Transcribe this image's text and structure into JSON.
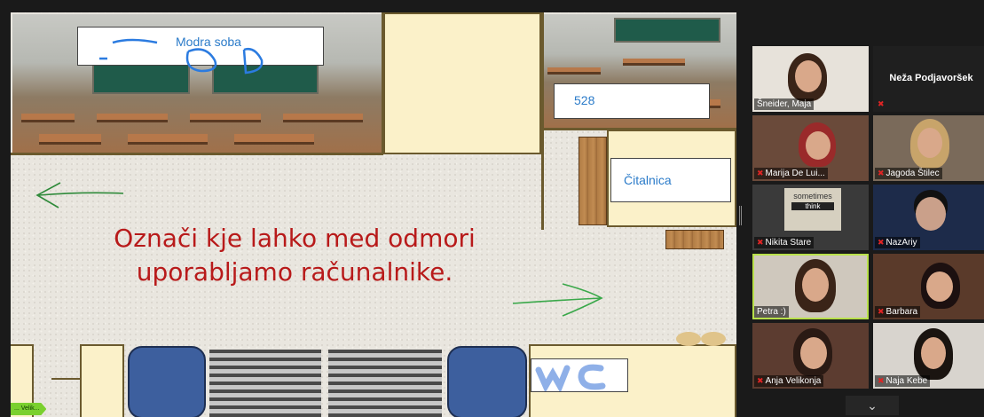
{
  "slide": {
    "rooms": {
      "top_left_label": "Modra soba",
      "top_right_label": "528",
      "reading_room_label": "Čitalnica"
    },
    "instruction_line1": "Označi kje lahko med odmori",
    "instruction_line2": "uporabljamo računalnike."
  },
  "participants": [
    {
      "name": "Šneider, Maja",
      "muted": false
    },
    {
      "name": "Neža Podjavoršek",
      "muted": true
    },
    {
      "name": "Marija De Lui...",
      "muted": true
    },
    {
      "name": "Jagoda Štilec",
      "muted": true
    },
    {
      "name": "Nikita Stare",
      "muted": true
    },
    {
      "name": "NazAriy",
      "muted": true
    },
    {
      "name": "Petra :)",
      "muted": false
    },
    {
      "name": "Barbara",
      "muted": true
    },
    {
      "name": "Anja Velikonja",
      "muted": true
    },
    {
      "name": "Naja Kebe",
      "muted": true
    }
  ],
  "tile_poster_text": [
    "sometimes",
    "think"
  ],
  "presenter_badge": "... Velik...",
  "colors": {
    "active_speaker": "#b8e04a",
    "instruction_text": "#b81a1a",
    "label_text": "#2b7bc9",
    "badge": "#7ad02e"
  },
  "icons": {
    "mic_muted": "muted-mic-icon",
    "scroll_down": "chevron-down-icon"
  }
}
